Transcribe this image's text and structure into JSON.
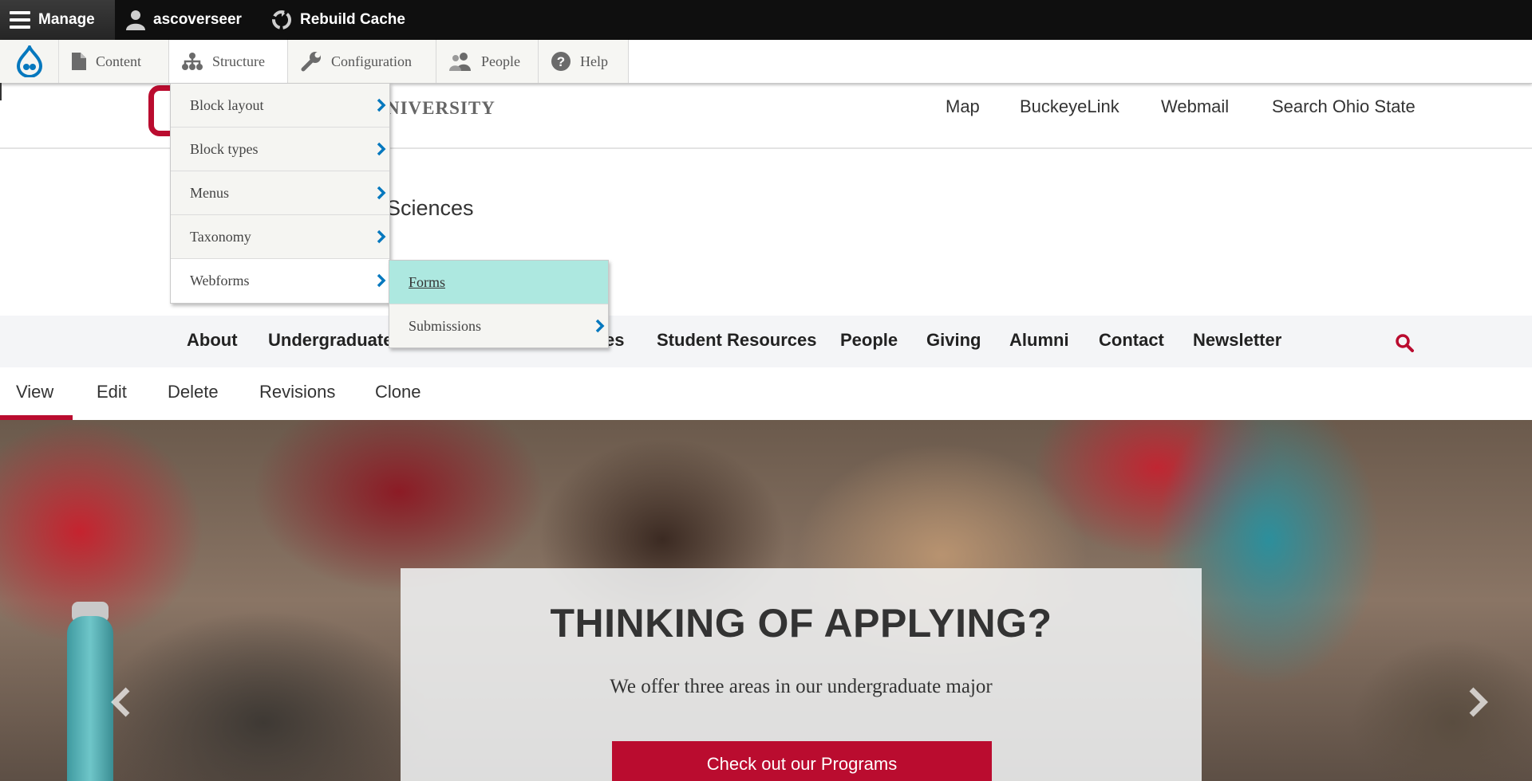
{
  "admin_bar": {
    "manage_label": "Manage",
    "user_label": "ascoverseer",
    "cache_label": "Rebuild Cache"
  },
  "admin_tray": {
    "tabs": [
      {
        "label": "Content",
        "icon": "file-icon"
      },
      {
        "label": "Structure",
        "icon": "sitemap-icon"
      },
      {
        "label": "Configuration",
        "icon": "wrench-icon"
      },
      {
        "label": "People",
        "icon": "people-icon"
      },
      {
        "label": "Help",
        "icon": "help-icon"
      }
    ],
    "logo_icon": "drupal-drop-icon"
  },
  "structure_menu": {
    "items": [
      {
        "label": "Block layout"
      },
      {
        "label": "Block types"
      },
      {
        "label": "Menus"
      },
      {
        "label": "Taxonomy"
      },
      {
        "label": "Webforms"
      }
    ],
    "webforms_flyout": [
      {
        "label": "Forms"
      },
      {
        "label": "Submissions"
      }
    ]
  },
  "site_header": {
    "university_fragment": "NIVERSITY",
    "links": [
      "Map",
      "BuckeyeLink",
      "Webmail",
      "Search Ohio State"
    ]
  },
  "site_title_fragment": "Sciences",
  "main_nav": {
    "items": [
      "About",
      "Undergraduate",
      "es",
      "Student Resources",
      "People",
      "Giving",
      "Alumni",
      "Contact",
      "Newsletter"
    ],
    "search_icon": "search-icon"
  },
  "local_tabs": {
    "items": [
      "View",
      "Edit",
      "Delete",
      "Revisions",
      "Clone"
    ],
    "active": "View"
  },
  "hero": {
    "heading": "THINKING OF APPLYING?",
    "subheading": "We offer three areas in our undergraduate major",
    "cta_label": "Check out our Programs"
  },
  "colors": {
    "brand_red": "#ba0c2f",
    "admin_bar_bg": "#0f0f0f",
    "drupal_blue": "#0678be",
    "menu_highlight": "#ade8e0"
  }
}
